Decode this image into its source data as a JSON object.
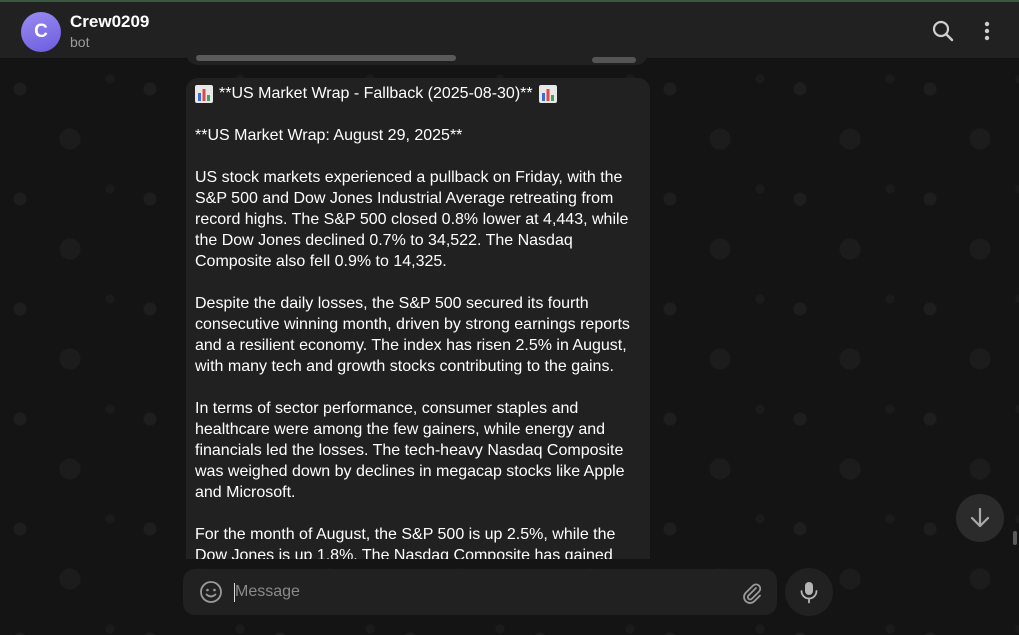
{
  "header": {
    "avatar_letter": "C",
    "title": "Crew0209",
    "subtitle": "bot",
    "icons": {
      "search": "search-icon",
      "menu": "more-vertical-icon"
    }
  },
  "message": {
    "title": "**US Market Wrap - Fallback (2025-08-30)**",
    "title_icon": "bar-chart-emoji-icon",
    "paragraphs": [
      "**US Market Wrap: August 29, 2025**",
      "US stock markets experienced a pullback on Friday, with the S&P 500 and Dow Jones Industrial Average retreating from record highs. The S&P 500 closed 0.8% lower at 4,443, while the Dow Jones declined 0.7% to 34,522. The Nasdaq Composite also fell 0.9% to 14,325.",
      "Despite the daily losses, the S&P 500 secured its fourth consecutive winning month, driven by strong earnings reports and a resilient economy. The index has risen 2.5% in August, with many tech and growth stocks contributing to the gains.",
      "In terms of sector performance, consumer staples and healthcare were among the few gainers, while energy and financials led the losses. The tech-heavy Nasdaq Composite was weighed down by declines in megacap stocks like Apple and Microsoft.",
      "For the month of August, the S&P 500 is up 2.5%, while the Dow Jones is up 1.8%. The Nasdaq Composite has gained"
    ]
  },
  "composer": {
    "placeholder": "Message",
    "icons": {
      "emoji": "smiley-icon",
      "attach": "paperclip-icon",
      "mic": "microphone-icon"
    }
  },
  "scroll_button_icon": "arrow-down-icon",
  "colors": {
    "header_bg": "#212121",
    "bubble_bg": "#212121",
    "chat_bg": "#141414",
    "avatar_gradient": [
      "#9a8cf2",
      "#6c5ce0"
    ]
  }
}
